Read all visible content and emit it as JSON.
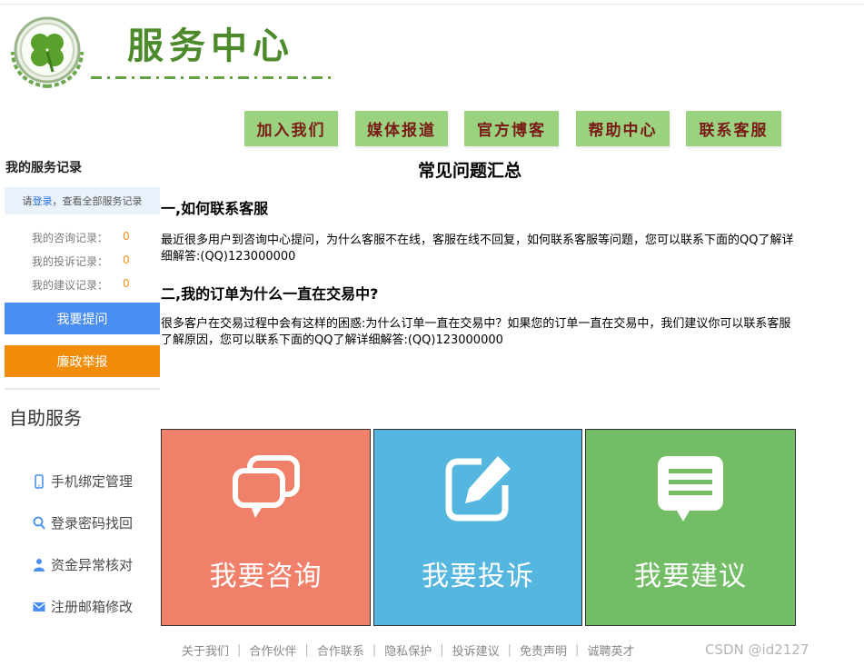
{
  "header": {
    "site_title": "服务中心",
    "logo_icon": "four-leaf-clover-icon"
  },
  "nav": [
    {
      "label": "加入我们"
    },
    {
      "label": "媒体报道"
    },
    {
      "label": "官方博客"
    },
    {
      "label": "帮助中心"
    },
    {
      "label": "联系客服"
    }
  ],
  "sidebar": {
    "heading": "我的服务记录",
    "login_prefix": "请 ",
    "login_link": "登录",
    "login_suffix": "，查看全部服务记录",
    "records": [
      {
        "label": "我的咨询记录：",
        "value": "0"
      },
      {
        "label": "我的投诉记录：",
        "value": "0"
      },
      {
        "label": "我的建议记录：",
        "value": "0"
      }
    ],
    "ask_button": "我要提问",
    "report_button": "廉政举报",
    "self_service_heading": "自助服务",
    "self_service_items": [
      {
        "label": "手机绑定管理",
        "icon": "phone-icon"
      },
      {
        "label": "登录密码找回",
        "icon": "search-icon"
      },
      {
        "label": "资金异常核对",
        "icon": "user-icon"
      },
      {
        "label": "注册邮箱修改",
        "icon": "mail-icon"
      }
    ]
  },
  "main": {
    "faq_title": "常见问题汇总",
    "questions": [
      {
        "title": "一,如何联系客服",
        "body": "最近很多用户到咨询中心提问，为什么客服不在线，客服在线不回复，如何联系客服等问题，您可以联系下面的QQ了解详细解答:(QQ)123000000"
      },
      {
        "title": "二,我的订单为什么一直在交易中?",
        "body": "很多客户在交易过程中会有这样的困惑:为什么订单一直在交易中？如果您的订单一直在交易中，我们建议你可以联系客服了解原因，您可以联系下面的QQ了解详细解答:(QQ)123000000"
      }
    ],
    "tiles": [
      {
        "label": "我要咨询",
        "icon": "chat-bubbles-icon",
        "color": "#f0806a"
      },
      {
        "label": "我要投诉",
        "icon": "edit-icon",
        "color": "#55b6e0"
      },
      {
        "label": "我要建议",
        "icon": "note-icon",
        "color": "#73bd67"
      }
    ]
  },
  "footer": {
    "links": [
      "关于我们",
      "合作伙伴",
      "合作联系",
      "隐私保护",
      "投诉建议",
      "免责声明",
      "诚聘英才"
    ],
    "separator": "|",
    "watermark": "CSDN @id2127"
  },
  "colors": {
    "nav_bg": "#9ad27f",
    "nav_text": "#7a1a16",
    "ask_blue": "#4a8ef1",
    "report_orange": "#f28c0b",
    "record_value": "#f39019"
  }
}
